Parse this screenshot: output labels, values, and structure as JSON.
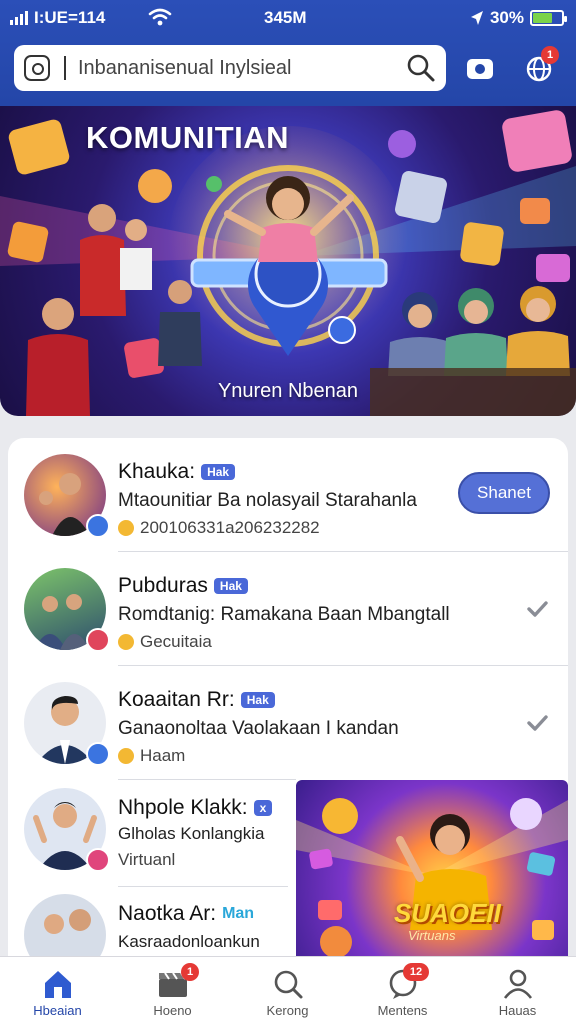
{
  "status_bar": {
    "carrier": "I:UE=114",
    "time": "345M",
    "battery_percent": "30%",
    "battery_level": 0.62
  },
  "search": {
    "placeholder": "Inbananisenual Inylsieal"
  },
  "header_badges": {
    "notifications": "1"
  },
  "hero": {
    "title": "KOMUNITIAN",
    "caption": "Ynuren Nbenan"
  },
  "list": {
    "items": [
      {
        "name": "Khauka:",
        "tag": "Hak",
        "description": "Mtaounitiar Ba nolasyail Starahanla",
        "meta": "200106331a206232282",
        "action_label": "Shanet"
      },
      {
        "name": "Pubduras",
        "tag": "Hak",
        "description": "Romdtanig: Ramakana Baan Mbangtall",
        "meta": "Gecuitaia"
      },
      {
        "name": "Koaaitan Rr:",
        "tag": "Hak",
        "description": "Ganaonoltaa Vaolakaan I kandan",
        "meta": "Haam"
      },
      {
        "name": "Nhpole Klakk:",
        "tag": "x",
        "description": "Glholas Konlangkia",
        "meta": "Virtuanl"
      },
      {
        "name": "Naotka Ar:",
        "tag": "Man",
        "description": "Kasraadonloankun",
        "meta": ""
      }
    ]
  },
  "promo": {
    "title": "SUAOEII",
    "subtitle": "Virtuans"
  },
  "bottom_nav": {
    "items": [
      {
        "label": "Hbeaian",
        "badge": ""
      },
      {
        "label": "Hoeno",
        "badge": "1"
      },
      {
        "label": "Kerong",
        "badge": ""
      },
      {
        "label": "Mentens",
        "badge": "12"
      },
      {
        "label": "Hauas",
        "badge": ""
      }
    ]
  },
  "colors": {
    "header_blue": "#2446a8",
    "accent": "#4a68d8",
    "badge_red": "#e53935"
  }
}
